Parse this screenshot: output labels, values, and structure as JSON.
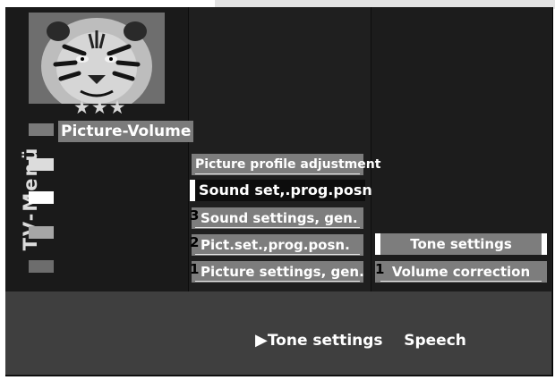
{
  "menu_title": "TV-Menü",
  "rating_stars": "★★★",
  "volume_label": "Picture-Volume",
  "main_menu": [
    {
      "num": "",
      "label": "Picture profile adjustment"
    },
    {
      "num": "",
      "label": "Sound set,.prog.posn"
    },
    {
      "num": "3",
      "label": "Sound settings, gen."
    },
    {
      "num": "2",
      "label": "Pict.set.,prog.posn."
    },
    {
      "num": "1",
      "label": "Picture settings, gen."
    }
  ],
  "sub_menu": [
    {
      "num": "",
      "label": "Tone settings"
    },
    {
      "num": "1",
      "label": "Volume correction"
    }
  ],
  "status": {
    "arrow": "▶",
    "current": "Tone settings",
    "next": "Speech"
  },
  "colors": {
    "background": "#1b1b1b",
    "item_gray": "#7d7d7d",
    "highlight": "#ffffff"
  }
}
